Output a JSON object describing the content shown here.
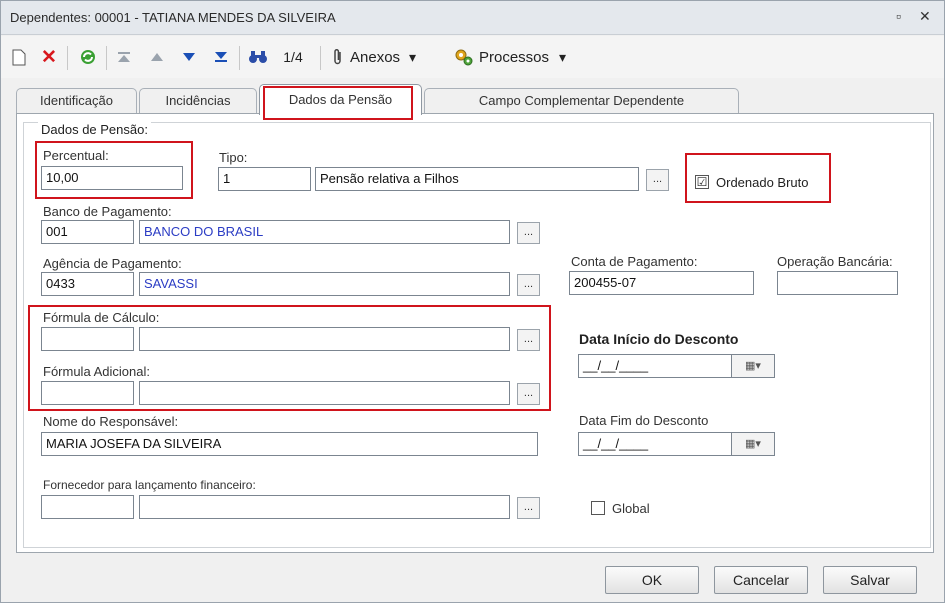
{
  "window": {
    "title": "Dependentes: 00001 - TATIANA MENDES DA SILVEIRA",
    "restore_glyph": "▫",
    "close_glyph": "✕"
  },
  "toolbar": {
    "record_counter": "1/4",
    "anexos_label": "Anexos",
    "processos_label": "Processos",
    "dropdown_glyph": "▾"
  },
  "tabs": [
    {
      "label": "Identificação"
    },
    {
      "label": "Incidências"
    },
    {
      "label": "Dados da Pensão"
    },
    {
      "label": "Campo Complementar Dependente"
    }
  ],
  "form": {
    "group_title": "Dados de Pensão:",
    "percentual": {
      "label": "Percentual:",
      "value": "10,00"
    },
    "tipo": {
      "label": "Tipo:",
      "code": "1",
      "description": "Pensão relativa a Filhos"
    },
    "ordenado_bruto": {
      "label": "Ordenado Bruto",
      "checked": true,
      "mark": "☑"
    },
    "banco": {
      "label": "Banco de  Pagamento:",
      "code": "001",
      "name": "BANCO DO BRASIL"
    },
    "agencia": {
      "label": "Agência de Pagamento:",
      "code": "0433",
      "name": "SAVASSI"
    },
    "conta": {
      "label": "Conta de Pagamento:",
      "value": "200455-07"
    },
    "operacao": {
      "label": "Operação Bancária:",
      "value": ""
    },
    "formula_calculo": {
      "label": "Fórmula de Cálculo:",
      "code": "",
      "description": ""
    },
    "formula_adicional": {
      "label": "Fórmula Adicional:",
      "code": "",
      "description": ""
    },
    "data_inicio": {
      "label": "Data Início do Desconto",
      "value": "__/__/____"
    },
    "data_fim": {
      "label": "Data Fim do Desconto",
      "value": "__/__/____"
    },
    "responsavel": {
      "label": "Nome do Responsável:",
      "value": "MARIA JOSEFA DA SILVEIRA"
    },
    "fornecedor": {
      "label": "Fornecedor para lançamento financeiro:",
      "code": "",
      "description": ""
    },
    "global": {
      "label": "Global",
      "checked": false
    },
    "ellipsis": "..."
  },
  "buttons": {
    "ok": "OK",
    "cancel": "Cancelar",
    "save": "Salvar"
  },
  "colors": {
    "highlight": "#d0141c",
    "link_blue": "#2b3cc4"
  }
}
